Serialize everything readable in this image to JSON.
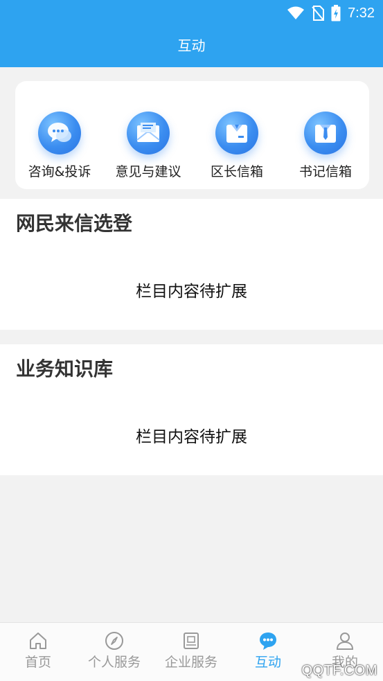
{
  "status_bar": {
    "time": "7:32",
    "icons": [
      "wifi-icon",
      "no-sim-icon",
      "battery-charging-icon"
    ]
  },
  "header": {
    "title": "互动"
  },
  "quick_actions": [
    {
      "label": "咨询&投诉",
      "icon": "chat-bubbles-icon"
    },
    {
      "label": "意见与建议",
      "icon": "envelope-icon"
    },
    {
      "label": "区长信箱",
      "icon": "suit-icon"
    },
    {
      "label": "书记信箱",
      "icon": "suit-tie-icon"
    }
  ],
  "sections": [
    {
      "title": "网民来信选登",
      "placeholder": "栏目内容待扩展"
    },
    {
      "title": "业务知识库",
      "placeholder": "栏目内容待扩展"
    }
  ],
  "bottom_nav": {
    "active_index": 3,
    "items": [
      {
        "label": "首页",
        "icon": "home-icon"
      },
      {
        "label": "个人服务",
        "icon": "compass-icon"
      },
      {
        "label": "企业服务",
        "icon": "briefcase-book-icon"
      },
      {
        "label": "互动",
        "icon": "chat-dots-icon"
      },
      {
        "label": "我的",
        "icon": "user-icon"
      }
    ]
  },
  "watermark": "QQTF.COM",
  "colors": {
    "primary": "#2ea3f0",
    "inactive": "#999999",
    "background": "#f2f2f2"
  }
}
